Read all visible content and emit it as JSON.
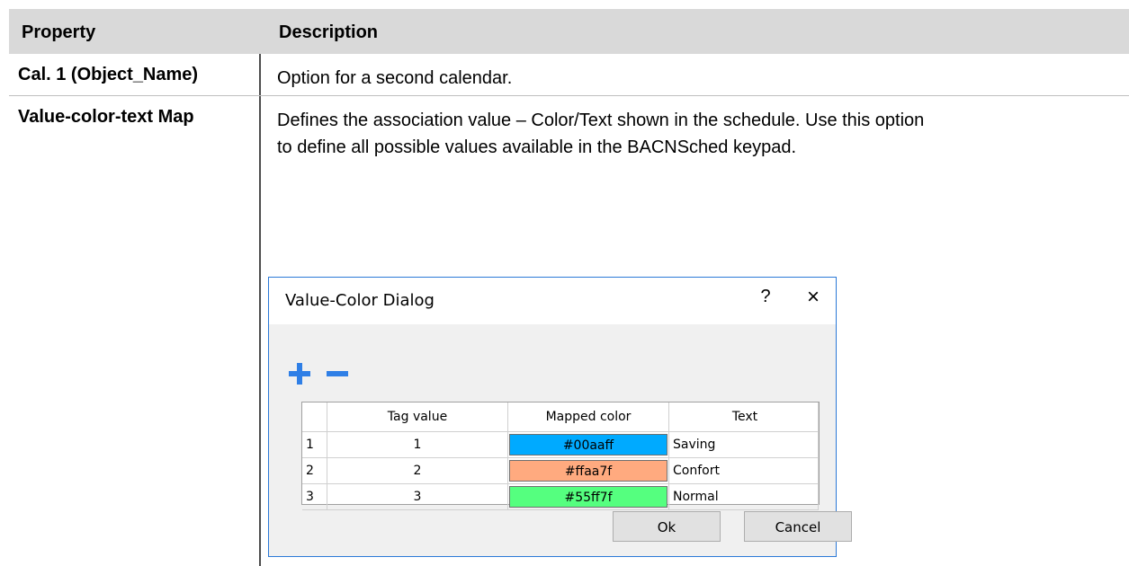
{
  "table": {
    "headers": {
      "property": "Property",
      "description": "Description"
    },
    "rows": [
      {
        "property": "Cal. 1 (Object_Name)",
        "description": "Option for a second calendar."
      },
      {
        "property": "Value-color-text Map",
        "description_line1": "Defines the association value – Color/Text shown in the schedule. Use this option",
        "description_line2": "to define all possible values available in the BACNSched keypad."
      }
    ]
  },
  "dialog": {
    "title": "Value-Color Dialog",
    "help_glyph": "?",
    "close_glyph": "×",
    "columns": [
      "Tag value",
      "Mapped color",
      "Text"
    ],
    "rows": [
      {
        "index": "1",
        "tag_value": "1",
        "mapped_color": "#00aaff",
        "text": "Saving"
      },
      {
        "index": "2",
        "tag_value": "2",
        "mapped_color": "#ffaa7f",
        "text": "Confort"
      },
      {
        "index": "3",
        "tag_value": "3",
        "mapped_color": "#55ff7f",
        "text": "Normal"
      }
    ],
    "ok_label": "Ok",
    "cancel_label": "Cancel"
  },
  "colors": {
    "header_bg": "#d9d9d9",
    "dialog_border": "#2b79d7",
    "icon_blue": "#2f7fe6"
  }
}
